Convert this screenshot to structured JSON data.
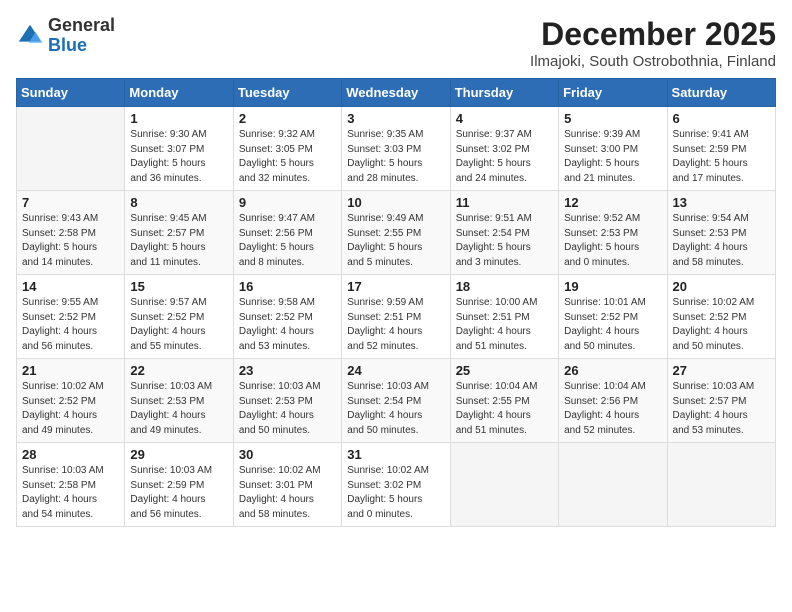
{
  "logo": {
    "general": "General",
    "blue": "Blue"
  },
  "header": {
    "month": "December 2025",
    "location": "Ilmajoki, South Ostrobothnia, Finland"
  },
  "days_of_week": [
    "Sunday",
    "Monday",
    "Tuesday",
    "Wednesday",
    "Thursday",
    "Friday",
    "Saturday"
  ],
  "weeks": [
    [
      {
        "day": "",
        "info": ""
      },
      {
        "day": "1",
        "info": "Sunrise: 9:30 AM\nSunset: 3:07 PM\nDaylight: 5 hours\nand 36 minutes."
      },
      {
        "day": "2",
        "info": "Sunrise: 9:32 AM\nSunset: 3:05 PM\nDaylight: 5 hours\nand 32 minutes."
      },
      {
        "day": "3",
        "info": "Sunrise: 9:35 AM\nSunset: 3:03 PM\nDaylight: 5 hours\nand 28 minutes."
      },
      {
        "day": "4",
        "info": "Sunrise: 9:37 AM\nSunset: 3:02 PM\nDaylight: 5 hours\nand 24 minutes."
      },
      {
        "day": "5",
        "info": "Sunrise: 9:39 AM\nSunset: 3:00 PM\nDaylight: 5 hours\nand 21 minutes."
      },
      {
        "day": "6",
        "info": "Sunrise: 9:41 AM\nSunset: 2:59 PM\nDaylight: 5 hours\nand 17 minutes."
      }
    ],
    [
      {
        "day": "7",
        "info": "Sunrise: 9:43 AM\nSunset: 2:58 PM\nDaylight: 5 hours\nand 14 minutes."
      },
      {
        "day": "8",
        "info": "Sunrise: 9:45 AM\nSunset: 2:57 PM\nDaylight: 5 hours\nand 11 minutes."
      },
      {
        "day": "9",
        "info": "Sunrise: 9:47 AM\nSunset: 2:56 PM\nDaylight: 5 hours\nand 8 minutes."
      },
      {
        "day": "10",
        "info": "Sunrise: 9:49 AM\nSunset: 2:55 PM\nDaylight: 5 hours\nand 5 minutes."
      },
      {
        "day": "11",
        "info": "Sunrise: 9:51 AM\nSunset: 2:54 PM\nDaylight: 5 hours\nand 3 minutes."
      },
      {
        "day": "12",
        "info": "Sunrise: 9:52 AM\nSunset: 2:53 PM\nDaylight: 5 hours\nand 0 minutes."
      },
      {
        "day": "13",
        "info": "Sunrise: 9:54 AM\nSunset: 2:53 PM\nDaylight: 4 hours\nand 58 minutes."
      }
    ],
    [
      {
        "day": "14",
        "info": "Sunrise: 9:55 AM\nSunset: 2:52 PM\nDaylight: 4 hours\nand 56 minutes."
      },
      {
        "day": "15",
        "info": "Sunrise: 9:57 AM\nSunset: 2:52 PM\nDaylight: 4 hours\nand 55 minutes."
      },
      {
        "day": "16",
        "info": "Sunrise: 9:58 AM\nSunset: 2:52 PM\nDaylight: 4 hours\nand 53 minutes."
      },
      {
        "day": "17",
        "info": "Sunrise: 9:59 AM\nSunset: 2:51 PM\nDaylight: 4 hours\nand 52 minutes."
      },
      {
        "day": "18",
        "info": "Sunrise: 10:00 AM\nSunset: 2:51 PM\nDaylight: 4 hours\nand 51 minutes."
      },
      {
        "day": "19",
        "info": "Sunrise: 10:01 AM\nSunset: 2:52 PM\nDaylight: 4 hours\nand 50 minutes."
      },
      {
        "day": "20",
        "info": "Sunrise: 10:02 AM\nSunset: 2:52 PM\nDaylight: 4 hours\nand 50 minutes."
      }
    ],
    [
      {
        "day": "21",
        "info": "Sunrise: 10:02 AM\nSunset: 2:52 PM\nDaylight: 4 hours\nand 49 minutes."
      },
      {
        "day": "22",
        "info": "Sunrise: 10:03 AM\nSunset: 2:53 PM\nDaylight: 4 hours\nand 49 minutes."
      },
      {
        "day": "23",
        "info": "Sunrise: 10:03 AM\nSunset: 2:53 PM\nDaylight: 4 hours\nand 50 minutes."
      },
      {
        "day": "24",
        "info": "Sunrise: 10:03 AM\nSunset: 2:54 PM\nDaylight: 4 hours\nand 50 minutes."
      },
      {
        "day": "25",
        "info": "Sunrise: 10:04 AM\nSunset: 2:55 PM\nDaylight: 4 hours\nand 51 minutes."
      },
      {
        "day": "26",
        "info": "Sunrise: 10:04 AM\nSunset: 2:56 PM\nDaylight: 4 hours\nand 52 minutes."
      },
      {
        "day": "27",
        "info": "Sunrise: 10:03 AM\nSunset: 2:57 PM\nDaylight: 4 hours\nand 53 minutes."
      }
    ],
    [
      {
        "day": "28",
        "info": "Sunrise: 10:03 AM\nSunset: 2:58 PM\nDaylight: 4 hours\nand 54 minutes."
      },
      {
        "day": "29",
        "info": "Sunrise: 10:03 AM\nSunset: 2:59 PM\nDaylight: 4 hours\nand 56 minutes."
      },
      {
        "day": "30",
        "info": "Sunrise: 10:02 AM\nSunset: 3:01 PM\nDaylight: 4 hours\nand 58 minutes."
      },
      {
        "day": "31",
        "info": "Sunrise: 10:02 AM\nSunset: 3:02 PM\nDaylight: 5 hours\nand 0 minutes."
      },
      {
        "day": "",
        "info": ""
      },
      {
        "day": "",
        "info": ""
      },
      {
        "day": "",
        "info": ""
      }
    ]
  ]
}
